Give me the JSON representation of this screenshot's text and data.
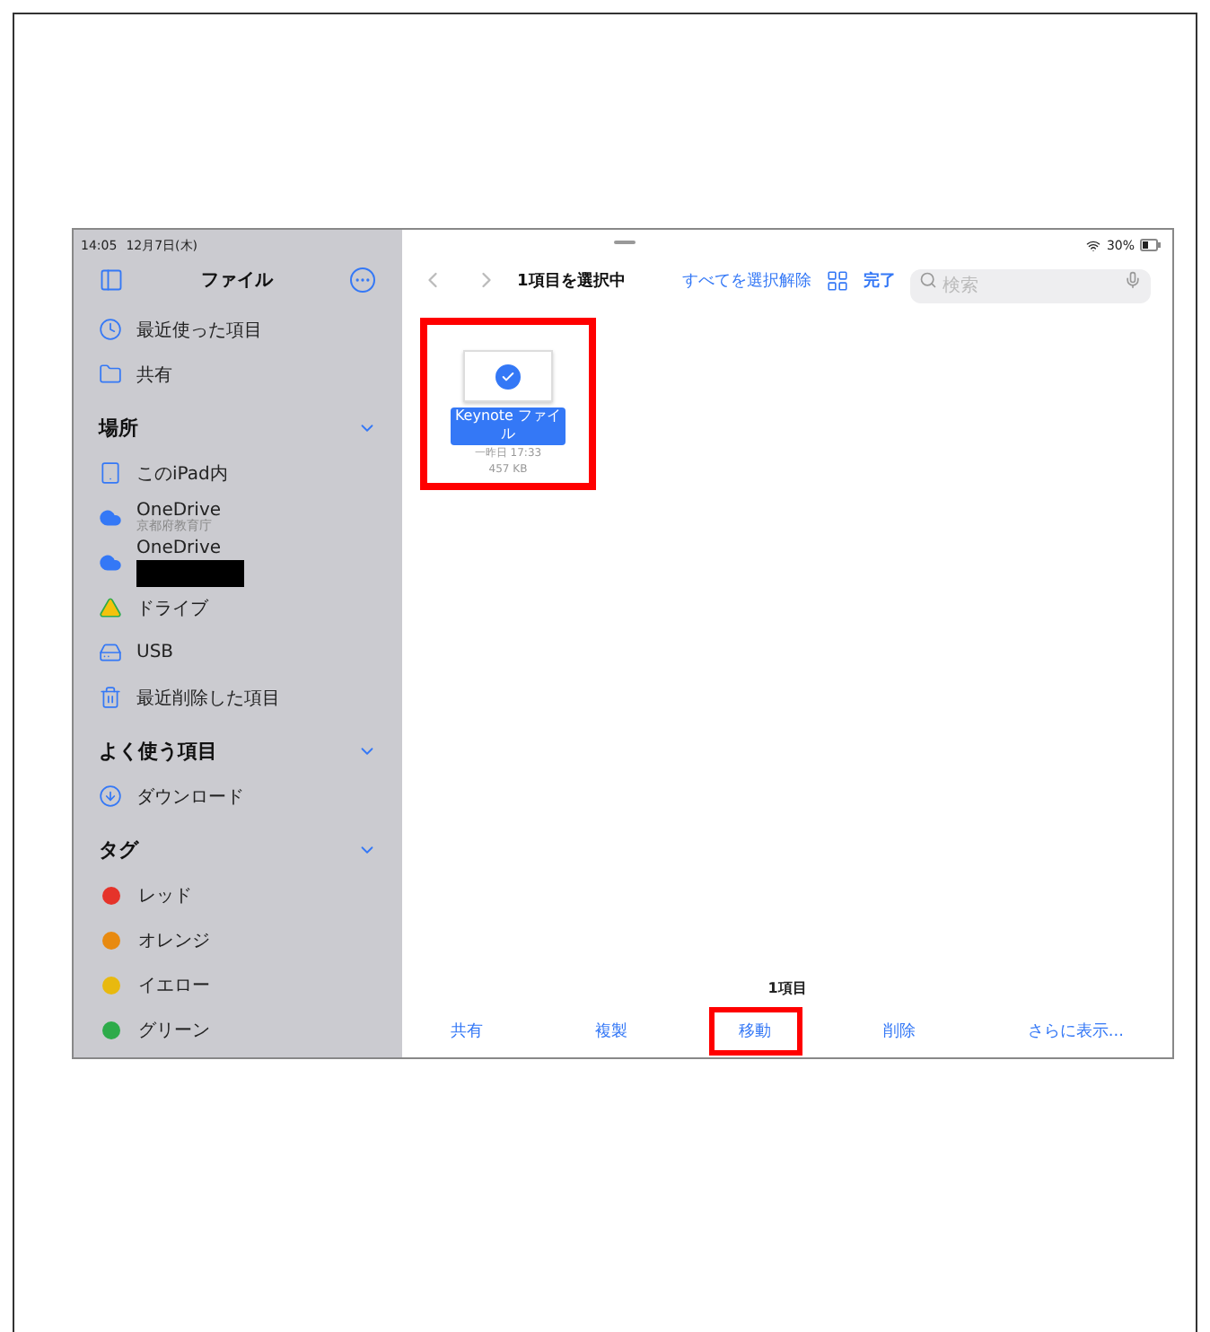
{
  "status_bar": {
    "time": "14:05",
    "date": "12月7日(木)",
    "battery": "30%"
  },
  "sidebar": {
    "title": "ファイル",
    "top_items": [
      {
        "kind": "recent",
        "label": "最近使った項目"
      },
      {
        "kind": "shared",
        "label": "共有"
      }
    ],
    "sections": [
      {
        "title": "場所",
        "expanded": true,
        "items": [
          {
            "kind": "device",
            "label": "このiPad内"
          },
          {
            "kind": "cloud",
            "label": "OneDrive",
            "subtitle": "京都府教育庁"
          },
          {
            "kind": "cloud",
            "label": "OneDrive",
            "redacted": true
          },
          {
            "kind": "drive",
            "label": "ドライブ"
          },
          {
            "kind": "usb",
            "label": "USB"
          },
          {
            "kind": "trash",
            "label": "最近削除した項目"
          }
        ]
      },
      {
        "title": "よく使う項目",
        "expanded": true,
        "items": [
          {
            "kind": "download",
            "label": "ダウンロード"
          }
        ]
      },
      {
        "title": "タグ",
        "expanded": true,
        "items": [
          {
            "kind": "tag",
            "label": "レッド",
            "color": "#e5332a"
          },
          {
            "kind": "tag",
            "label": "オレンジ",
            "color": "#e88a10"
          },
          {
            "kind": "tag",
            "label": "イエロー",
            "color": "#e8b90f"
          },
          {
            "kind": "tag",
            "label": "グリーン",
            "color": "#2eab4a"
          }
        ]
      }
    ]
  },
  "toolbar": {
    "title": "1項目を選択中",
    "deselect": "すべてを選択解除",
    "done": "完了",
    "search": {
      "placeholder": "検索"
    }
  },
  "files": [
    {
      "name": "Keynote ファイル",
      "date": "一昨日 17:33",
      "size": "457 KB",
      "selected": true,
      "highlighted": true
    }
  ],
  "footer": {
    "count": "1項目",
    "actions": [
      {
        "label": "共有",
        "highlighted": false
      },
      {
        "label": "複製",
        "highlighted": false
      },
      {
        "label": "移動",
        "highlighted": true
      },
      {
        "label": "削除",
        "highlighted": false
      },
      {
        "label": "さらに表示...",
        "highlighted": false
      }
    ]
  }
}
